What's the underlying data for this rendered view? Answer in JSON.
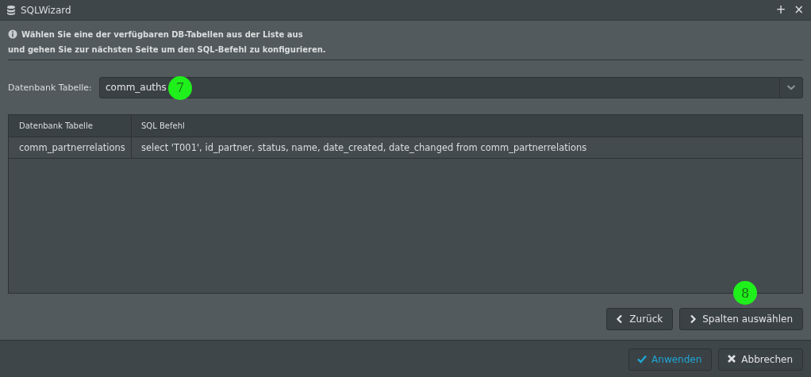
{
  "window": {
    "title": "SQLWizard",
    "controls": [
      "+",
      "×"
    ]
  },
  "info": {
    "lines": [
      "Wählen Sie eine der verfügbaren DB-Tabellen aus der Liste aus",
      "und gehen Sie zur nächsten Seite um den SQL-Befehl zu konfigurieren."
    ]
  },
  "table_select": {
    "label": "Datenbank Tabelle:",
    "value": "comm_auths",
    "marker": "7"
  },
  "table": {
    "columns": [
      "Datenbank Tabelle",
      "SQL Befehl"
    ],
    "rows": [
      [
        "comm_partnerrelations",
        "select 'T001', id_partner, status, name, date_created, date_changed from comm_partnerrelations"
      ]
    ]
  },
  "nav_buttons": [
    {
      "label": "Zurück",
      "kind": "back"
    },
    {
      "label": "Spalten auswählen",
      "kind": "next",
      "marker": "8"
    }
  ],
  "footer_buttons": [
    {
      "label": "Anwenden",
      "kind": "apply"
    },
    {
      "label": "Abbrechen",
      "kind": "cancel"
    }
  ]
}
